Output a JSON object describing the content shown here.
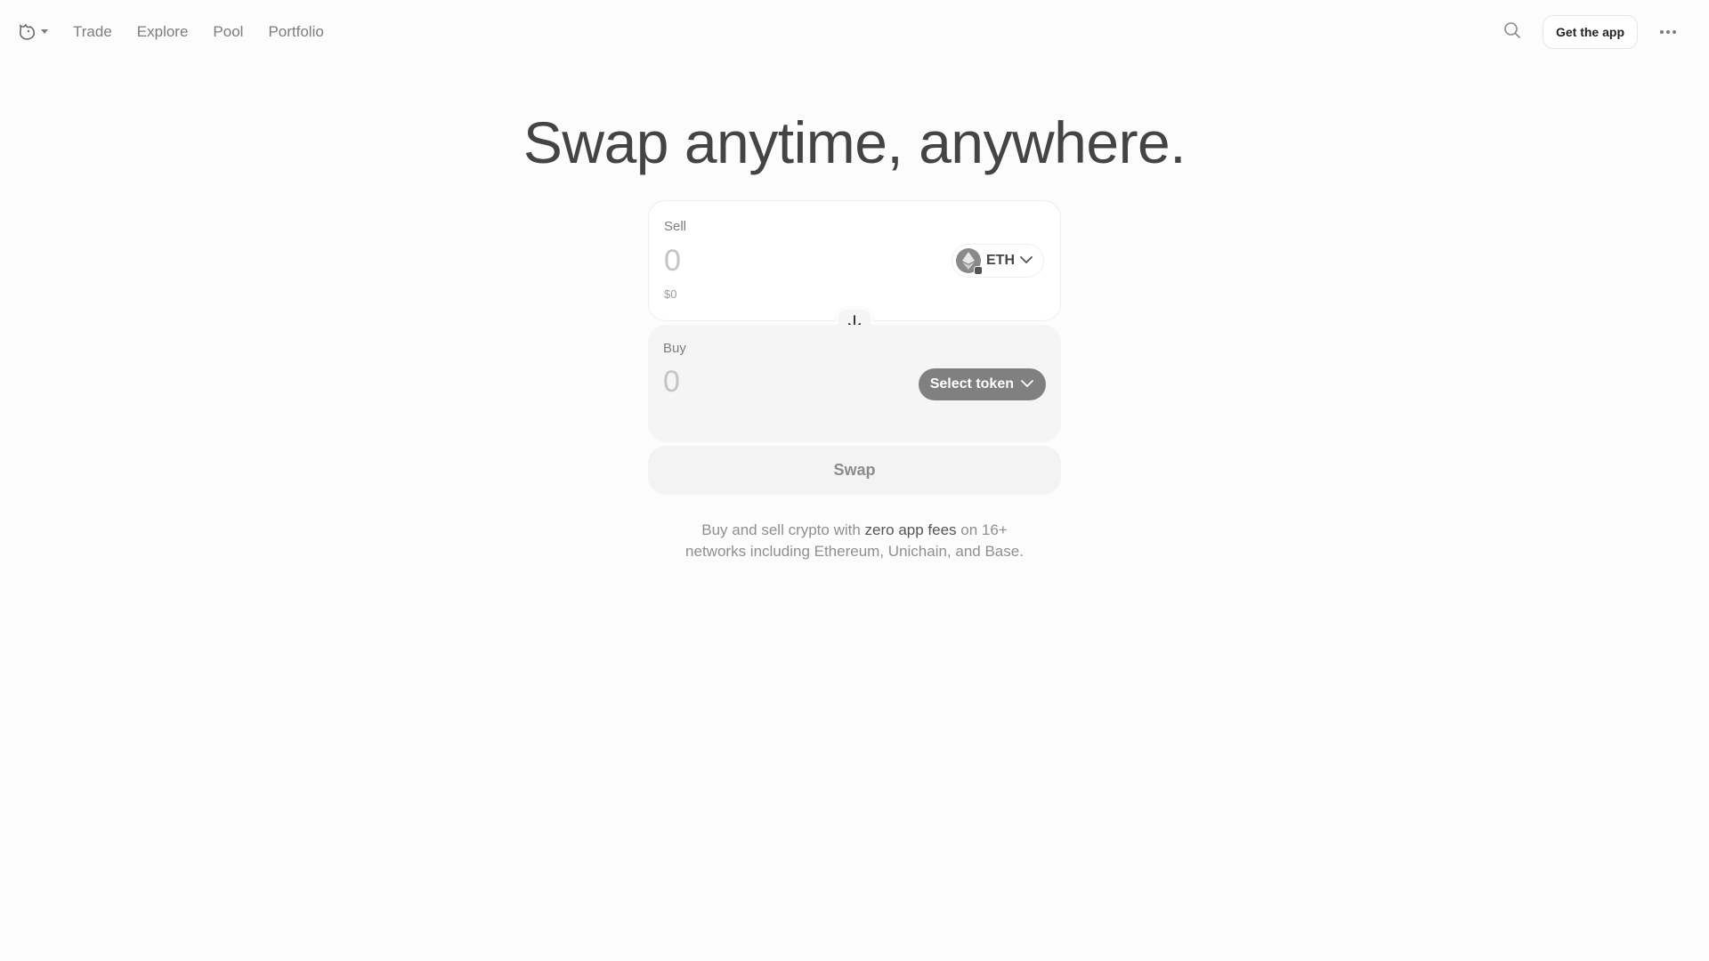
{
  "nav": {
    "links": [
      "Trade",
      "Explore",
      "Pool",
      "Portfolio"
    ],
    "get_app_label": "Get the app"
  },
  "hero": {
    "headline": "Swap anytime, anywhere."
  },
  "sell": {
    "label": "Sell",
    "amount_placeholder": "0",
    "usd_value": "$0",
    "token": "ETH"
  },
  "buy": {
    "label": "Buy",
    "amount_placeholder": "0",
    "select_token_label": "Select token"
  },
  "swap_button_label": "Swap",
  "footer_text": {
    "part1": "Buy and sell crypto with ",
    "highlight": "zero app fees",
    "part2": " on 16+",
    "line2": "networks including Ethereum, Unichain, and Base."
  },
  "icons": {
    "logo": "unicorn-logo-icon",
    "search": "search-icon",
    "more": "more-dots-icon",
    "switch": "arrow-down-icon",
    "chevron": "chevron-down-icon",
    "eth": "eth-token-icon"
  }
}
